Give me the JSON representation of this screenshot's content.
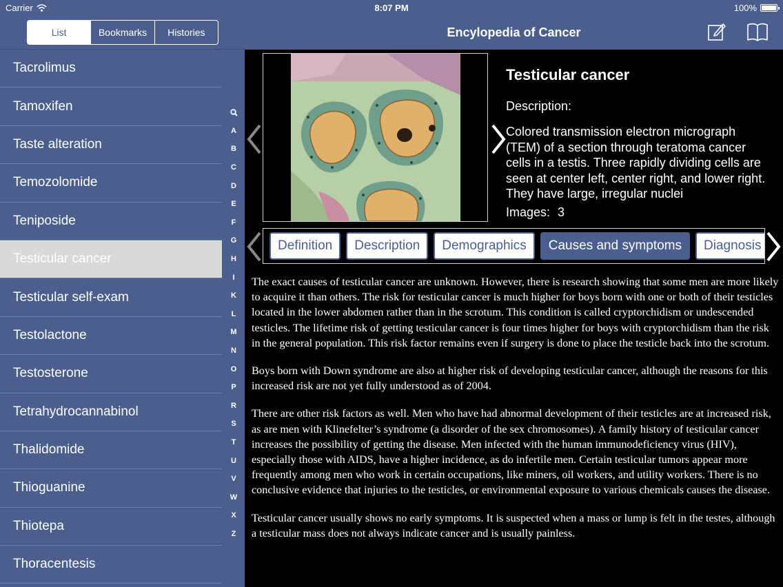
{
  "status": {
    "carrier": "Carrier",
    "time": "8:07 PM",
    "battery": "100%"
  },
  "sidebar": {
    "segments": [
      "List",
      "Bookmarks",
      "Histories"
    ],
    "items": [
      "Tacrolimus",
      "Tamoxifen",
      "Taste alteration",
      "Temozolomide",
      "Teniposide",
      "Testicular cancer",
      "Testicular self-exam",
      "Testolactone",
      "Testosterone",
      "Tetrahydrocannabinol",
      "Thalidomide",
      "Thioguanine",
      "Thiotepa",
      "Thoracentesis"
    ],
    "index": [
      "A",
      "B",
      "C",
      "D",
      "E",
      "F",
      "G",
      "H",
      "I",
      "K",
      "L",
      "M",
      "N",
      "O",
      "P",
      "R",
      "S",
      "T",
      "U",
      "V",
      "W",
      "X",
      "Z"
    ]
  },
  "header": {
    "title": "Encylopedia of Cancer"
  },
  "entry": {
    "name": "Testicular cancer",
    "description_label": "Description:",
    "description": "Colored transmission electron micrograph (TEM) of a section through teratoma cancer cells in a testis. Three rapidly dividing cells are seen at center left, center right, and lower right. They have large, irregular nuclei",
    "images_label": "Images:",
    "images_count": "3"
  },
  "tabs": [
    "Definition",
    "Description",
    "Demographics",
    "Causes and symptoms",
    "Diagnosis"
  ],
  "article": [
    "The exact causes of testicular cancer are unknown. However, there is research showing that some men are more likely to acquire it than others. The risk for testicular cancer is much higher for boys born with one or both of their testicles located in the lower abdomen rather than in the scrotum. This condition is called cryptorchidism or undescended testicles. The lifetime risk of getting testicular cancer is four times higher for boys with cryptorchidism than the risk in the general population. This risk factor remains even if surgery is done to place the testicle back into the scrotum.",
    "Boys born with Down syndrome are also at higher risk of developing testicular cancer, although the reasons for this increased risk are not yet fully understood as of 2004.",
    "There are other risk factors as well. Men who have had abnormal development of their testicles are at increased risk, as are men with Klinefelter’s syndrome (a disorder of the sex chromosomes). A family history of testicular cancer increases the possibility of getting the disease. Men infected with the human immunodeficiency virus (HIV), especially those with AIDS, have a higher incidence, as do infertile men. Certain testicular tumors appear more frequently among men who work in certain occupations, like miners, oil workers, and utility workers. There is no conclusive evidence that injuries to the testicles, or environmental exposure to various chemicals causes the disease.",
    "Testicular cancer usually shows no early symptoms. It is suspected when a mass or lump is felt in the testes, although a testicular mass does not always indicate cancer and is usually painless."
  ],
  "colors": {
    "accent": "#4a5f8d",
    "selected_row": "#d9d9d9"
  }
}
